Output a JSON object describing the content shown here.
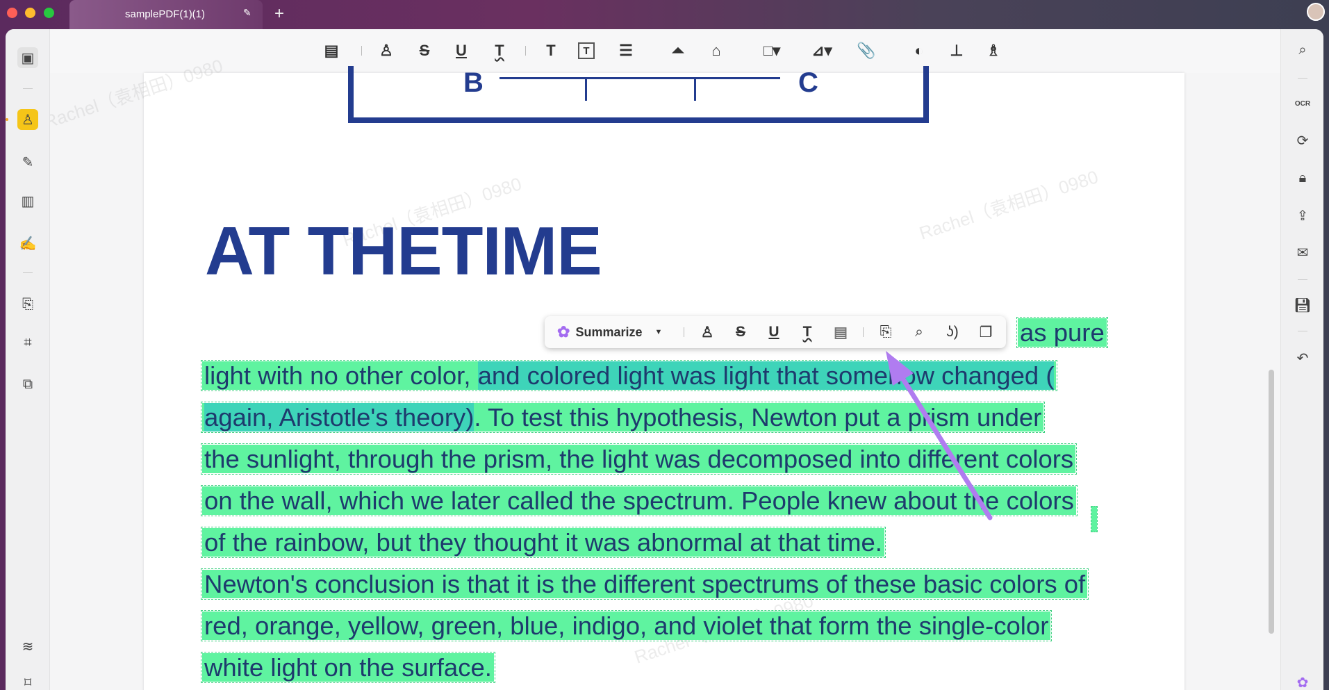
{
  "window": {
    "tab_title": "samplePDF(1)(1)",
    "new_tab": "+"
  },
  "diagram": {
    "label_b": "B",
    "label_c": "C"
  },
  "document": {
    "heading": "AT THETIME",
    "lines": [
      {
        "pre": "",
        "sel": "",
        "post": "as pure"
      },
      {
        "pre": "light with no other color, ",
        "sel": "and colored light was light that somehow changed (",
        "post": ""
      },
      {
        "pre": "",
        "sel": "again, Aristotle's theory)",
        "post": ". To test this hypothesis, Newton put a prism under"
      },
      {
        "pre": "the sunlight, through the prism, the light was decomposed into different colors",
        "sel": "",
        "post": ""
      },
      {
        "pre": "on the wall, which we later called the spectrum. People knew about the colors",
        "sel": "",
        "post": ""
      },
      {
        "pre": "of the rainbow, but they thought it was abnormal at that time.",
        "sel": "",
        "post": ""
      },
      {
        "pre": "Newton's conclusion is that it is the different spectrums of these basic colors of",
        "sel": "",
        "post": ""
      },
      {
        "pre": "red, orange, yellow, green, blue, indigo, and violet that form the single-color",
        "sel": "",
        "post": ""
      },
      {
        "pre": "white light on the surface.",
        "sel": "",
        "post": ""
      }
    ],
    "watermark": "Rachel（袁相田）0980"
  },
  "popup": {
    "summarize_label": "Summarize",
    "icons": [
      "highlight-icon",
      "strikethrough-icon",
      "underline-icon",
      "squiggly-icon",
      "note-icon",
      "bookmark-add-icon",
      "search-doc-icon",
      "read-aloud-icon",
      "copy-icon"
    ]
  },
  "colors": {
    "highlight": "#5ff3a0",
    "selection": "#3ed4b9",
    "heading": "#233c8f",
    "arrow": "#b07cf0"
  }
}
